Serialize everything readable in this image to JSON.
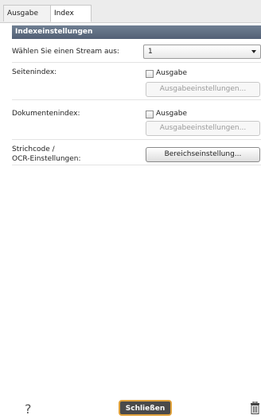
{
  "tabs": [
    {
      "label": "Ausgabe"
    },
    {
      "label": "Index"
    }
  ],
  "section": {
    "title": "Indexeinstellungen"
  },
  "stream": {
    "label": "Wählen Sie einen Stream aus:",
    "value": "1"
  },
  "seitenindex": {
    "label": "Seitenindex:",
    "checkbox_label": "Ausgabe",
    "button_label": "Ausgabeeinstellungen..."
  },
  "dokumentenindex": {
    "label": "Dokumentenindex:",
    "checkbox_label": "Ausgabe",
    "button_label": "Ausgabeeinstellungen..."
  },
  "barcode": {
    "label_line1": "Strichcode /",
    "label_line2": "OCR-Einstellungen:",
    "button_label": "Bereichseinstellung..."
  },
  "footer": {
    "help_symbol": "?",
    "close_label": "Schließen",
    "trash_icon": "trash-icon"
  },
  "colors": {
    "section_header": "#5b6a7f",
    "close_button_bg": "#4a4a4a",
    "close_button_border": "#e0a13a"
  }
}
